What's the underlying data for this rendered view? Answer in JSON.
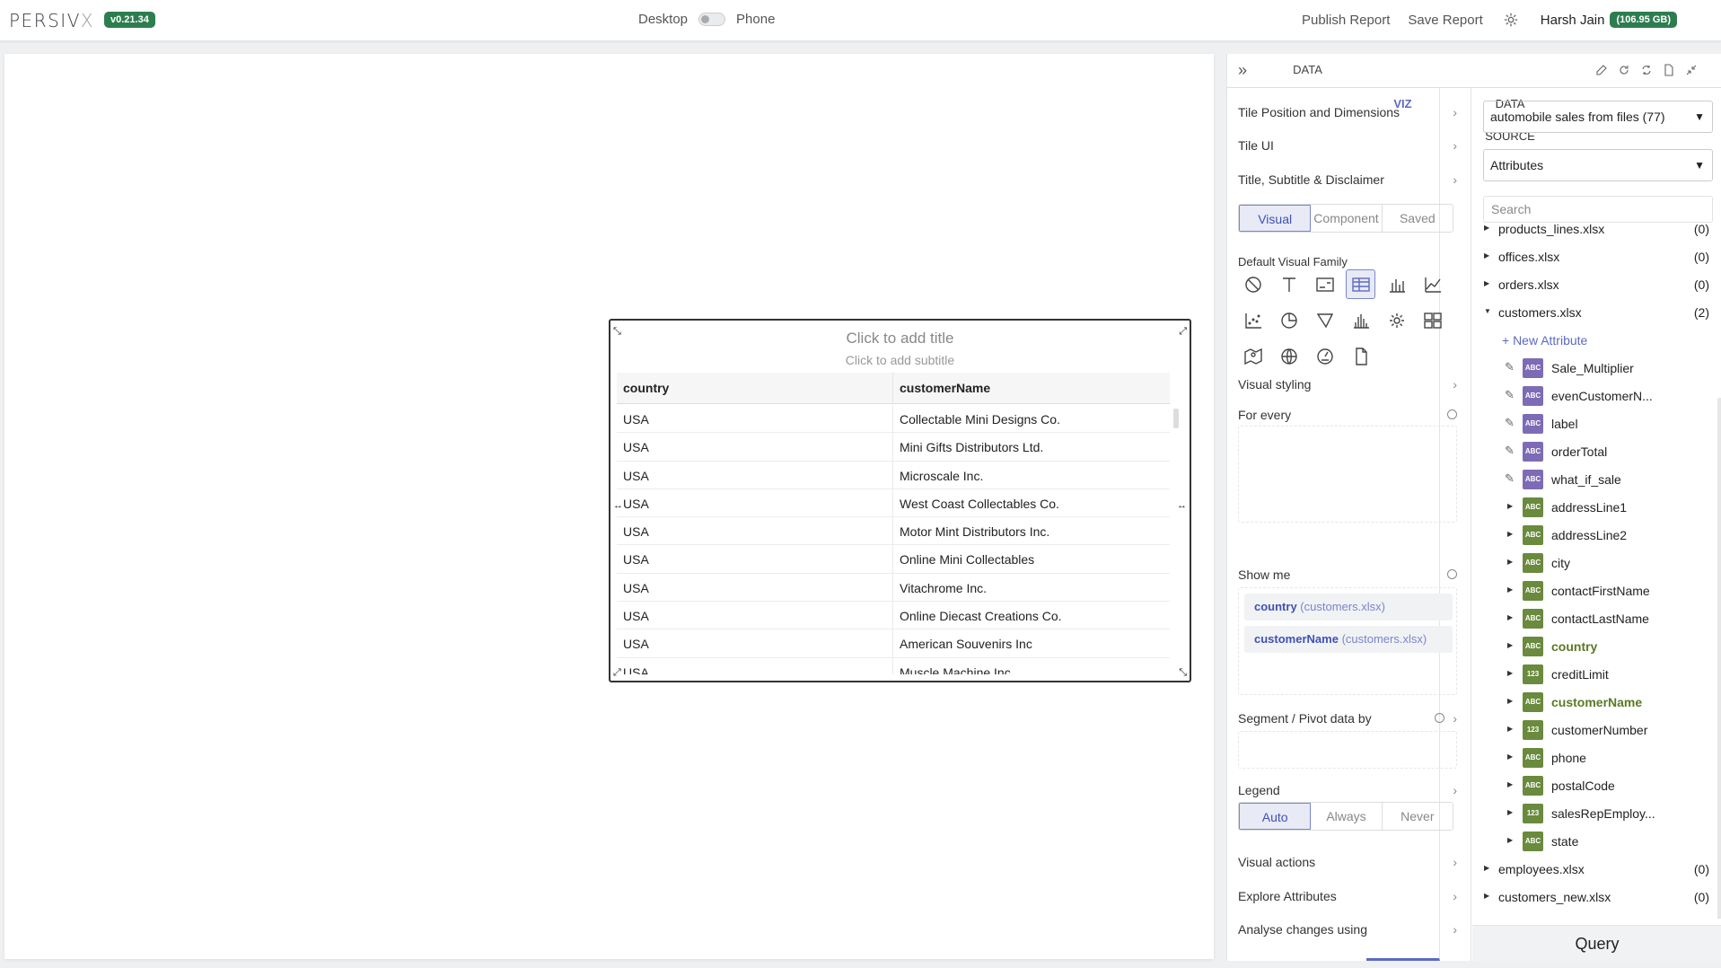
{
  "header": {
    "logo_main": "PERSIV",
    "logo_x": "X",
    "version": "v0.21.34",
    "mode_desktop": "Desktop",
    "mode_phone": "Phone",
    "publish_label": "Publish Report",
    "save_label": "Save Report",
    "user_name": "Harsh Jain",
    "quota": "(106.95 GB)"
  },
  "tile": {
    "title_placeholder": "Click to add title",
    "subtitle_placeholder": "Click to add subtitle",
    "columns": [
      "country",
      "customerName"
    ],
    "rows": [
      [
        "USA",
        "Collectable Mini Designs Co."
      ],
      [
        "USA",
        "Mini Gifts Distributors Ltd."
      ],
      [
        "USA",
        "Microscale Inc."
      ],
      [
        "USA",
        "West Coast Collectables Co."
      ],
      [
        "USA",
        "Motor Mint Distributors Inc."
      ],
      [
        "USA",
        "Online Mini Collectables"
      ],
      [
        "USA",
        "Vitachrome Inc."
      ],
      [
        "USA",
        "Online Diecast Creations Co."
      ],
      [
        "USA",
        "American Souvenirs Inc"
      ],
      [
        "USA",
        "Muscle Machine Inc"
      ]
    ]
  },
  "panel": {
    "tabs": {
      "data": "DATA",
      "viz": "VIZ",
      "data_source": "DATA SOURCE"
    },
    "viz": {
      "sections": {
        "tile_position": "Tile Position and Dimensions",
        "tile_ui": "Tile UI",
        "title_subtitle": "Title, Subtitle & Disclaimer",
        "default_visual_family": "Default Visual Family",
        "visual_styling": "Visual styling",
        "for_every": "For every",
        "show_me": "Show me",
        "segment_pivot": "Segment / Pivot data by",
        "legend": "Legend",
        "visual_actions": "Visual actions",
        "explore_attributes": "Explore Attributes",
        "analyse_changes": "Analyse changes using"
      },
      "visual_tabs": [
        "Visual",
        "Component",
        "Saved"
      ],
      "visual_tab_selected": "Visual",
      "legend_options": [
        "Auto",
        "Always",
        "Never"
      ],
      "legend_selected": "Auto",
      "visual_family_icons": [
        "none-icon",
        "text-icon",
        "image-card-icon",
        "table-icon",
        "bar-chart-icon",
        "line-chart-icon",
        "scatter-icon",
        "pie-chart-icon",
        "funnel-icon",
        "histogram-icon",
        "gear-icon",
        "layout-icon",
        "map-icon",
        "globe-icon",
        "gauge-icon",
        "document-icon"
      ],
      "visual_family_selected": "table-icon",
      "show_me_chips": [
        {
          "field": "country",
          "source": "(customers.xlsx)"
        },
        {
          "field": "customerName",
          "source": "(customers.xlsx)"
        }
      ]
    },
    "data_source": {
      "source_select": "automobile sales from files (77)",
      "type_select": "Attributes",
      "search_placeholder": "Search",
      "files_top": [
        {
          "name": "products_lines.xlsx",
          "count": "(0)"
        },
        {
          "name": "offices.xlsx",
          "count": "(0)"
        },
        {
          "name": "orders.xlsx",
          "count": "(0)"
        },
        {
          "name": "customers.xlsx",
          "count": "(2)"
        }
      ],
      "new_attribute": "+ New Attribute",
      "attributes": [
        {
          "name": "Sale_Multiplier",
          "type": "ABC",
          "custom": true,
          "selected": false
        },
        {
          "name": "evenCustomerN...",
          "type": "ABC",
          "custom": true,
          "selected": false
        },
        {
          "name": "label",
          "type": "ABC",
          "custom": true,
          "selected": false
        },
        {
          "name": "orderTotal",
          "type": "ABC",
          "custom": true,
          "selected": false
        },
        {
          "name": "what_if_sale",
          "type": "ABC",
          "custom": true,
          "selected": false
        },
        {
          "name": "addressLine1",
          "type": "ABC",
          "custom": false,
          "selected": false
        },
        {
          "name": "addressLine2",
          "type": "ABC",
          "custom": false,
          "selected": false
        },
        {
          "name": "city",
          "type": "ABC",
          "custom": false,
          "selected": false
        },
        {
          "name": "contactFirstName",
          "type": "ABC",
          "custom": false,
          "selected": false
        },
        {
          "name": "contactLastName",
          "type": "ABC",
          "custom": false,
          "selected": false
        },
        {
          "name": "country",
          "type": "ABC",
          "custom": false,
          "selected": true
        },
        {
          "name": "creditLimit",
          "type": "123",
          "custom": false,
          "selected": false
        },
        {
          "name": "customerName",
          "type": "ABC",
          "custom": false,
          "selected": true
        },
        {
          "name": "customerNumber",
          "type": "123",
          "custom": false,
          "selected": false
        },
        {
          "name": "phone",
          "type": "ABC",
          "custom": false,
          "selected": false
        },
        {
          "name": "postalCode",
          "type": "ABC",
          "custom": false,
          "selected": false
        },
        {
          "name": "salesRepEmploy...",
          "type": "123",
          "custom": false,
          "selected": false
        },
        {
          "name": "state",
          "type": "ABC",
          "custom": false,
          "selected": false
        }
      ],
      "files_bottom": [
        {
          "name": "employees.xlsx",
          "count": "(0)"
        },
        {
          "name": "customers_new.xlsx",
          "count": "(0)"
        }
      ],
      "query_label": "Query"
    }
  },
  "colors": {
    "brand_green": "#2e7d4f",
    "accent": "#5c6bc0",
    "attr_custom": "#7e6bb5",
    "attr_source": "#6a8a3e"
  }
}
